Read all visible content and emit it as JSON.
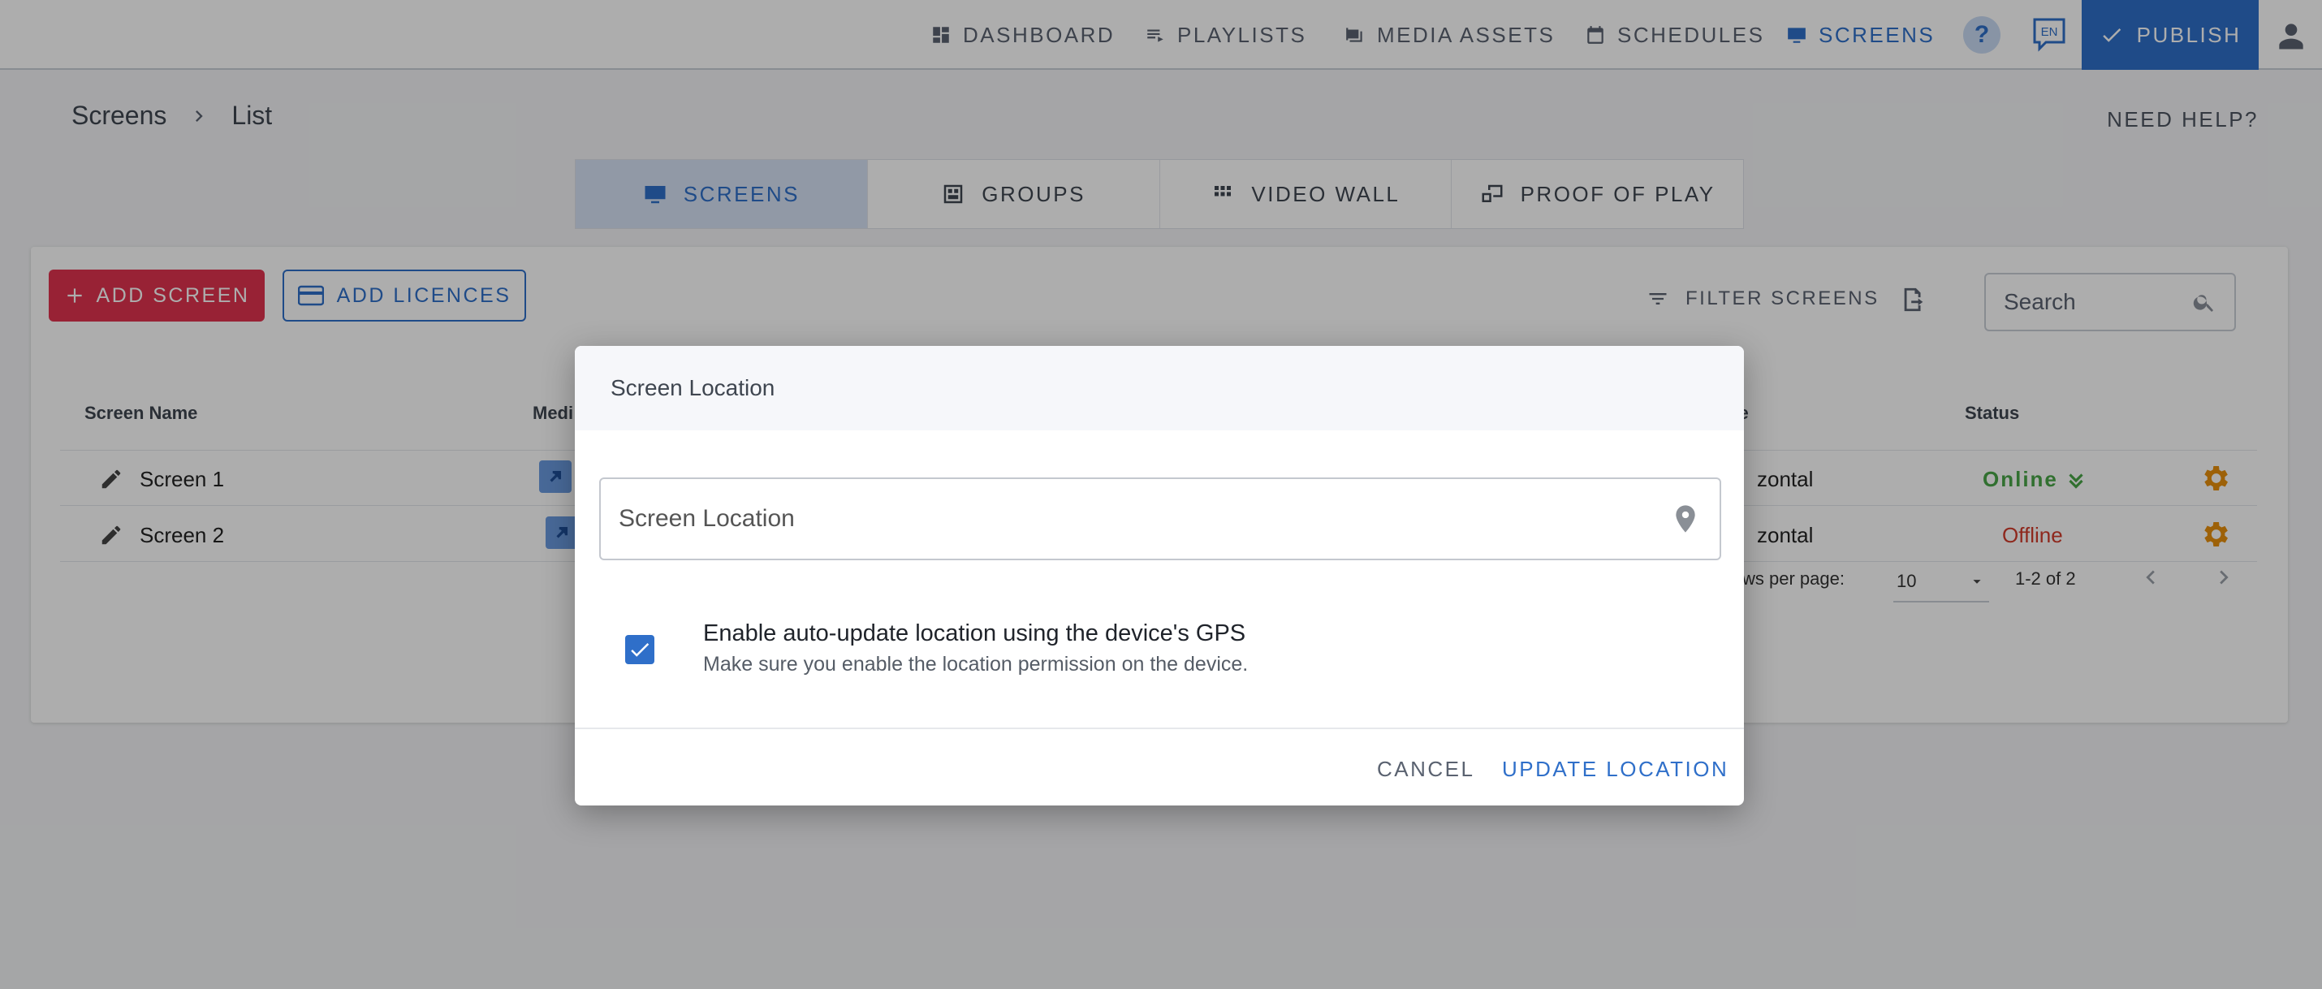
{
  "nav": {
    "dashboard": "DASHBOARD",
    "playlists": "PLAYLISTS",
    "media_assets": "MEDIA ASSETS",
    "schedules": "SCHEDULES",
    "screens": "SCREENS",
    "help": "?",
    "language": "EN",
    "publish": "PUBLISH"
  },
  "breadcrumb": {
    "root": "Screens",
    "current": "List"
  },
  "need_help": "NEED HELP?",
  "tabs": [
    {
      "label": "SCREENS",
      "icon": "monitor-icon"
    },
    {
      "label": "GROUPS",
      "icon": "groups-icon"
    },
    {
      "label": "VIDEO WALL",
      "icon": "grid-icon"
    },
    {
      "label": "PROOF OF PLAY",
      "icon": "proof-of-play-icon"
    }
  ],
  "toolbar": {
    "add_screen": "ADD SCREEN",
    "add_licences": "ADD LICENCES",
    "filter_screens": "FILTER SCREENS",
    "search_placeholder": "Search"
  },
  "table": {
    "headers": {
      "name": "Screen Name",
      "media": "Medi",
      "type": "be",
      "status": "Status"
    },
    "rows": [
      {
        "name": "Screen 1",
        "type": "zontal",
        "status": "Online"
      },
      {
        "name": "Screen 2",
        "type": "zontal",
        "status": "Offline"
      }
    ]
  },
  "pagination": {
    "rows_per_page_label": "ws per page:",
    "rows_per_page": "10",
    "range": "1-2 of 2"
  },
  "dialog": {
    "title": "Screen Location",
    "field_placeholder": "Screen Location",
    "checkbox_label": "Enable auto-update location using the device's GPS",
    "checkbox_hint": "Make sure you enable the location permission on the device.",
    "checkbox_checked": true,
    "cancel": "CANCEL",
    "update": "UPDATE LOCATION"
  },
  "colors": {
    "primary": "#2f6fc9",
    "add_screen": "#e0334f",
    "online": "#49a548",
    "offline": "#d23b2b",
    "gear": "#e8900c"
  }
}
